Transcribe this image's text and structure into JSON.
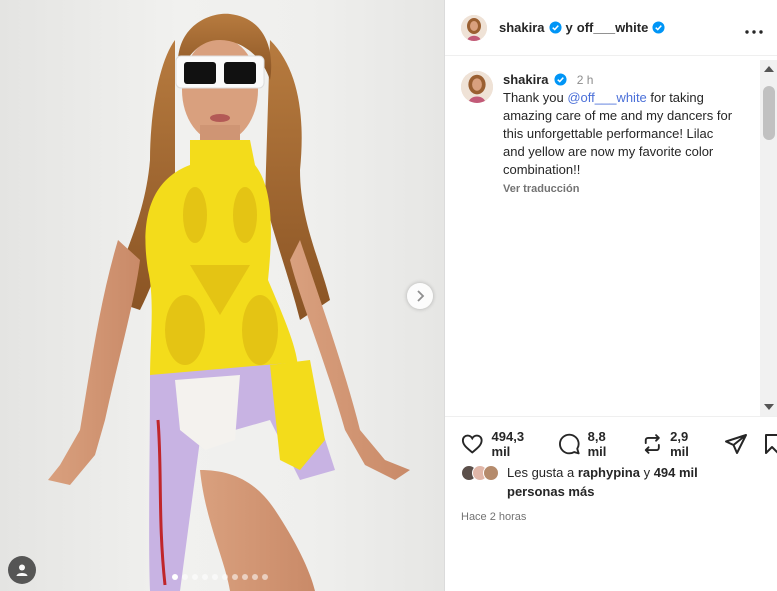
{
  "post": {
    "author": "shakira",
    "collaborator": "off___white",
    "joiner": "y",
    "more_icon": "more-horizontal-icon"
  },
  "caption": {
    "username": "shakira",
    "time": "2 h",
    "text_before": "Thank you ",
    "mention": "@off___white",
    "text_after": " for taking amazing care of me and my dancers for this unforgettable performance! Lilac and yellow are now my favorite color combination!!",
    "translate": "Ver traducción"
  },
  "actions": {
    "likes": "494,3 mil",
    "comments": "8,8 mil",
    "reposts": "2,9 mil",
    "icons": [
      "heart-icon",
      "comment-icon",
      "repost-icon",
      "share-icon",
      "save-icon"
    ]
  },
  "liked_by": {
    "prefix": "Les gusta a ",
    "user": "raphypina",
    "middle": " y ",
    "count": "494 mil",
    "suffix": "personas más"
  },
  "timestamp": "Hace 2 horas",
  "carousel": {
    "slide_count": 10,
    "active_index": 0
  },
  "colors": {
    "accent_blue": "#0095f6",
    "mention": "#4a6fd8",
    "dress_yellow": "#f3dc1b",
    "lilac": "#c8b3e3"
  }
}
